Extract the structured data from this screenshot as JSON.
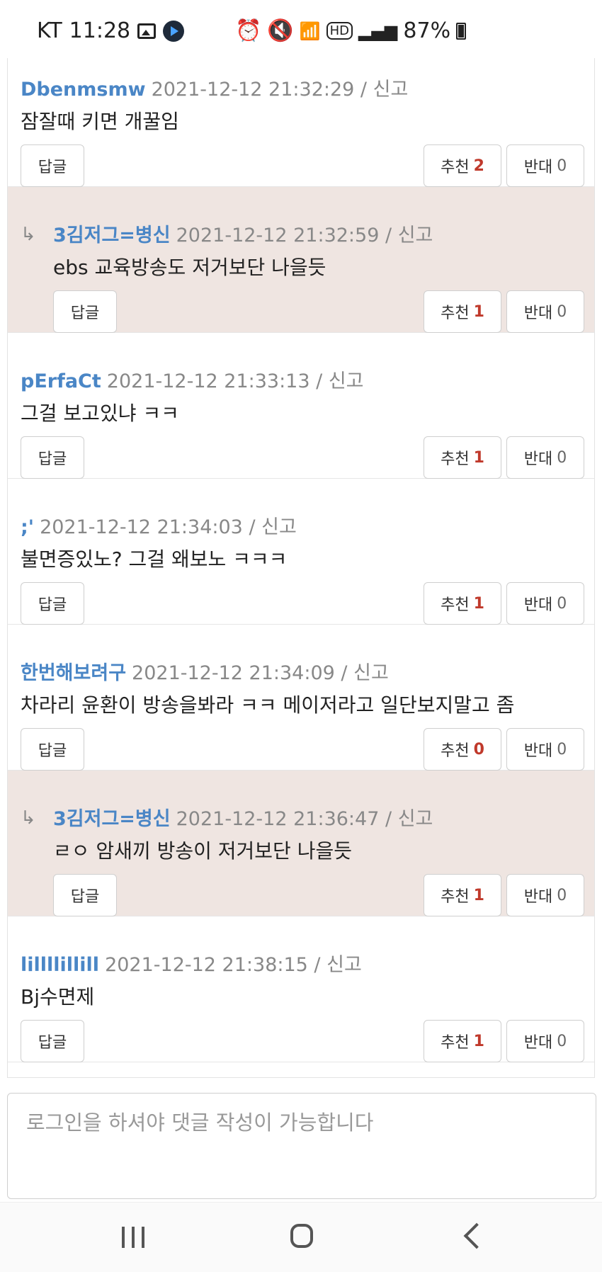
{
  "status_bar": {
    "carrier": "KT",
    "time": "11:28",
    "battery": "87%",
    "left_icons": [
      "image-icon",
      "play-icon"
    ],
    "right_icons": [
      "alarm-icon",
      "mute-icon",
      "wifi-6-icon",
      "hd-icon",
      "signal-icon",
      "battery-icon"
    ]
  },
  "comments": [
    {
      "author": "Dbenmsmw",
      "date": "2021-12-12 21:32:29",
      "sep": "/",
      "report": "신고",
      "text": "잠잘때 키면 개꿀임",
      "reply_label": "답글",
      "up_label": "추천",
      "up_count": "2",
      "down_label": "반대",
      "down_count": "0",
      "is_reply": false
    },
    {
      "author": "3김저그=병신",
      "date": "2021-12-12 21:32:59",
      "sep": "/",
      "report": "신고",
      "text": "ebs 교육방송도 저거보단 나을듯",
      "reply_label": "답글",
      "up_label": "추천",
      "up_count": "1",
      "down_label": "반대",
      "down_count": "0",
      "is_reply": true
    },
    {
      "author": "pErfaCt",
      "date": "2021-12-12 21:33:13",
      "sep": "/",
      "report": "신고",
      "text": "그걸 보고있냐 ㅋㅋ",
      "reply_label": "답글",
      "up_label": "추천",
      "up_count": "1",
      "down_label": "반대",
      "down_count": "0",
      "is_reply": false
    },
    {
      "author": ";'",
      "date": "2021-12-12 21:34:03",
      "sep": "/",
      "report": "신고",
      "text": "불면증있노? 그걸 왜보노 ㅋㅋㅋ",
      "reply_label": "답글",
      "up_label": "추천",
      "up_count": "1",
      "down_label": "반대",
      "down_count": "0",
      "is_reply": false
    },
    {
      "author": "한번해보려구",
      "date": "2021-12-12 21:34:09",
      "sep": "/",
      "report": "신고",
      "text": "차라리 윤환이 방송을봐라 ㅋㅋ 메이저라고 일단보지말고 좀",
      "reply_label": "답글",
      "up_label": "추천",
      "up_count": "0",
      "down_label": "반대",
      "down_count": "0",
      "is_reply": false
    },
    {
      "author": "3김저그=병신",
      "date": "2021-12-12 21:36:47",
      "sep": "/",
      "report": "신고",
      "text": "ㄹㅇ 암새끼 방송이 저거보단 나을듯",
      "reply_label": "답글",
      "up_label": "추천",
      "up_count": "1",
      "down_label": "반대",
      "down_count": "0",
      "is_reply": true
    },
    {
      "author": "lillllillill",
      "date": "2021-12-12 21:38:15",
      "sep": "/",
      "report": "신고",
      "text": "Bj수면제",
      "reply_label": "답글",
      "up_label": "추천",
      "up_count": "1",
      "down_label": "반대",
      "down_count": "0",
      "is_reply": false
    }
  ],
  "comment_input": {
    "placeholder": "로그인을 하셔야 댓글 작성이 가능합니다"
  },
  "nav_bar": {
    "icons": [
      "recent-apps-icon",
      "home-icon",
      "back-icon"
    ]
  },
  "colors": {
    "author": "#4a86c6",
    "reply_background": "#efe5e1",
    "recommend_count": "#c0392b"
  }
}
